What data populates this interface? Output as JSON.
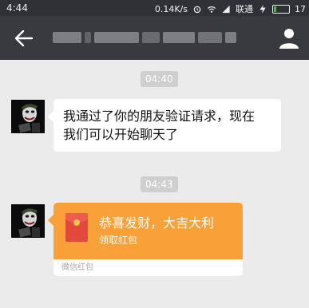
{
  "status_bar": {
    "time": "4:44",
    "net_speed": "0.14K/s",
    "carrier": "联通",
    "battery_level": "17",
    "battery_fraction": 0.17
  },
  "title_bar": {
    "back_icon": "arrow-left-icon",
    "title": "",
    "profile_icon": "person-icon"
  },
  "messages": [
    {
      "timestamp": "04:40",
      "text_lines": [
        "我通过了你的朋友验证请求，现在",
        "我们可以开始聊天了"
      ]
    },
    {
      "timestamp": "04:43",
      "red_packet": {
        "title": "恭喜发财，大吉大利",
        "subtitle": "领取红包",
        "footer": "微信红包",
        "colors": {
          "top": "#f9a139",
          "envelope": "#e1493c"
        }
      }
    }
  ],
  "colors": {
    "status_bar": "#2f3136",
    "title_bar": "#393a3f",
    "background": "#ebebeb"
  }
}
